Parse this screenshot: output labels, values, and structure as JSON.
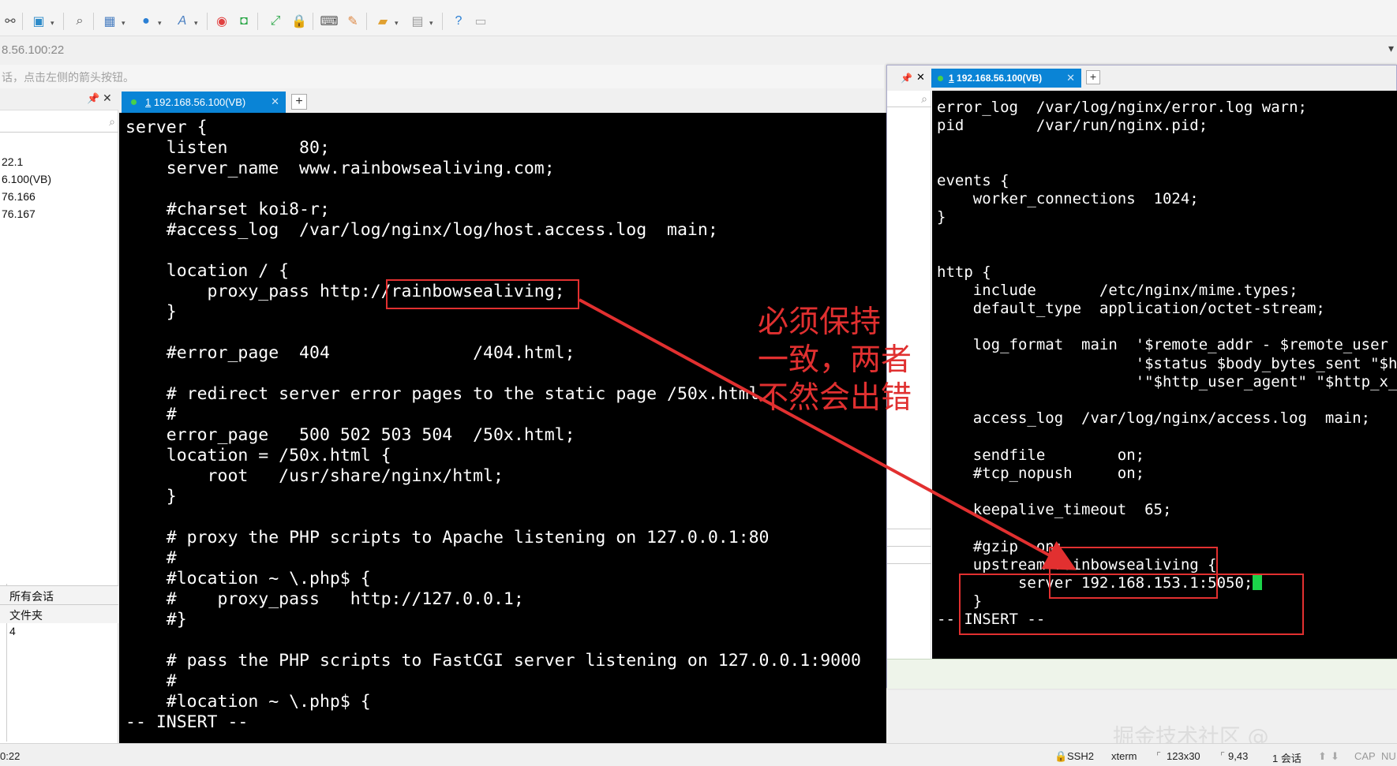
{
  "address": {
    "text": "8.56.100:22"
  },
  "hint": {
    "text": "话，点击左侧的箭头按钮。"
  },
  "sidebar": {
    "items": [
      {
        "label": "22.1"
      },
      {
        "label": "6.100(VB)"
      },
      {
        "label": "76.166"
      },
      {
        "label": "76.167"
      }
    ],
    "tabs": [
      {
        "label": "所有会话"
      },
      {
        "label": "文件夹"
      }
    ],
    "count": "4"
  },
  "left_tab": {
    "index": "1",
    "label": "192.168.56.100(VB)"
  },
  "right_tab": {
    "index": "1",
    "label": "192.168.56.100(VB)"
  },
  "left_terminal": {
    "lines": [
      "server {",
      "    listen       80;",
      "    server_name  www.rainbowsealiving.com;",
      "",
      "    #charset koi8-r;",
      "    #access_log  /var/log/nginx/log/host.access.log  main;",
      "",
      "    location / {",
      "        proxy_pass http://rainbowsealiving;",
      "    }",
      "",
      "    #error_page  404              /404.html;",
      "",
      "    # redirect server error pages to the static page /50x.html",
      "    #",
      "    error_page   500 502 503 504  /50x.html;",
      "    location = /50x.html {",
      "        root   /usr/share/nginx/html;",
      "    }",
      "",
      "    # proxy the PHP scripts to Apache listening on 127.0.0.1:80",
      "    #",
      "    #location ~ \\.php$ {",
      "    #    proxy_pass   http://127.0.0.1;",
      "    #}",
      "",
      "    # pass the PHP scripts to FastCGI server listening on 127.0.0.1:9000",
      "    #",
      "    #location ~ \\.php$ {",
      "-- INSERT --"
    ]
  },
  "right_terminal": {
    "lines": [
      "error_log  /var/log/nginx/error.log warn;",
      "pid        /var/run/nginx.pid;",
      "",
      "",
      "events {",
      "    worker_connections  1024;",
      "}",
      "",
      "",
      "http {",
      "    include       /etc/nginx/mime.types;",
      "    default_type  application/octet-stream;",
      "",
      "    log_format  main  '$remote_addr - $remote_user",
      "                      '$status $body_bytes_sent \"$h",
      "                      '\"$http_user_agent\" \"$http_x_",
      "",
      "    access_log  /var/log/nginx/access.log  main;",
      "",
      "    sendfile        on;",
      "    #tcp_nopush     on;",
      "",
      "    keepalive_timeout  65;",
      "",
      "    #gzip  on;",
      "    upstream rainbowsealiving {",
      "         server 192.168.153.1:5050;",
      "    }",
      "-- INSERT --"
    ]
  },
  "annotation": {
    "lines": [
      "必须保持",
      "一致，两者",
      "不然会出错"
    ]
  },
  "status": {
    "left": "0:22",
    "protocol": "SSH2",
    "term": "xterm",
    "size": "123x30",
    "pos": "9,43",
    "sessions": "1 会话",
    "caps": "CAP",
    "num": "NU"
  },
  "watermark": "掘金技术社区 @ RainbowSea",
  "colors": {
    "tab_blue": "#0a84d6",
    "annotation_red": "#e23030",
    "cursor_green": "#1bd34a"
  }
}
